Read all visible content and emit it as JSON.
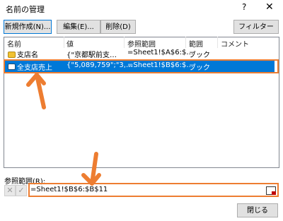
{
  "window": {
    "title": "名前の管理",
    "help_glyph": "?",
    "close_glyph": "✕"
  },
  "toolbar": {
    "new_label": "新規作成(N)...",
    "edit_label": "編集(E)...",
    "delete_label": "削除(D)",
    "filter_label": "フィルター(F) ▾"
  },
  "list": {
    "headers": [
      "名前",
      "値",
      "参照範囲",
      "範囲",
      "コメント"
    ],
    "rows": [
      {
        "name": "支店名",
        "value": "{\"京都駅前支…",
        "ref": "=Sheet1!$A$6:$…",
        "scope": "ブック",
        "comment": ""
      },
      {
        "name": "全支店売上",
        "value": "{\"5,089,759\";\"3,…",
        "ref": "=Sheet1!$B$6:$…",
        "scope": "ブック",
        "comment": ""
      }
    ]
  },
  "reference": {
    "label": "参照範囲(R):",
    "value": "=Sheet1!$B$6:$B$11"
  },
  "footer": {
    "close_label": "閉じる"
  },
  "annotation": {
    "color": "#ed7d31"
  }
}
